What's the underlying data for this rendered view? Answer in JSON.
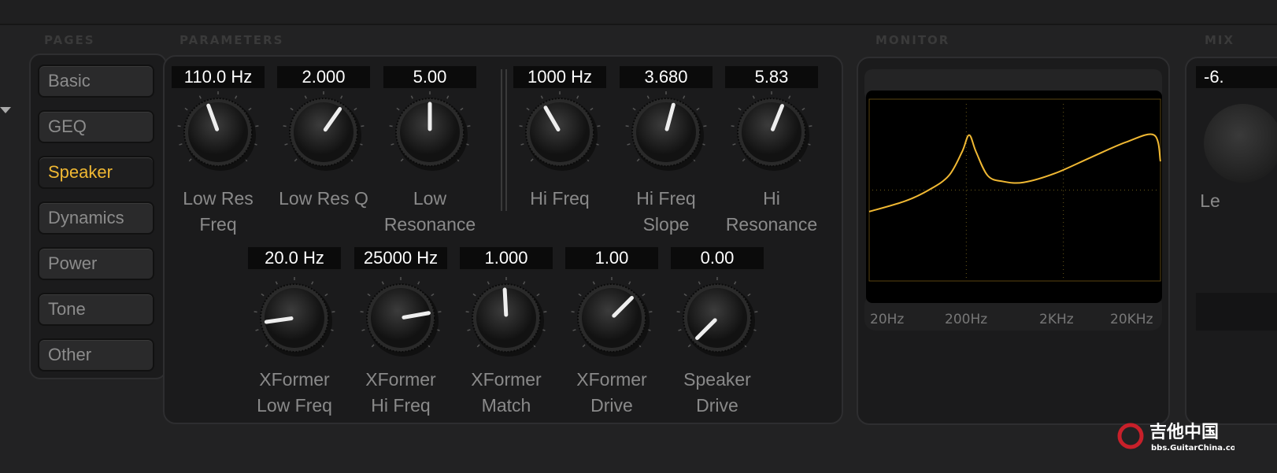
{
  "sections": {
    "pages": "PAGES",
    "parameters": "PARAMETERS",
    "monitor": "MONITOR",
    "mix": "MIX"
  },
  "pages": [
    {
      "label": "Basic",
      "active": false
    },
    {
      "label": "GEQ",
      "active": false
    },
    {
      "label": "Speaker",
      "active": true
    },
    {
      "label": "Dynamics",
      "active": false
    },
    {
      "label": "Power",
      "active": false
    },
    {
      "label": "Tone",
      "active": false
    },
    {
      "label": "Other",
      "active": false
    }
  ],
  "accent_color": "#f0b833",
  "knobs_row1": [
    {
      "value": "110.0 Hz",
      "label1": "Low Res",
      "label2": "Freq",
      "angle_deg": -20
    },
    {
      "value": "2.000",
      "label1": "Low Res Q",
      "label2": "",
      "angle_deg": 35
    },
    {
      "value": "5.00",
      "label1": "Low",
      "label2": "Resonance",
      "angle_deg": 0
    },
    {
      "value": "1000 Hz",
      "label1": "Hi Freq",
      "label2": "",
      "angle_deg": -30
    },
    {
      "value": "3.680",
      "label1": "Hi Freq",
      "label2": "Slope",
      "angle_deg": 15
    },
    {
      "value": "5.83",
      "label1": "Hi",
      "label2": "Resonance",
      "angle_deg": 22
    }
  ],
  "knobs_row2": [
    {
      "value": "20.0 Hz",
      "label1": "XFormer",
      "label2": "Low Freq",
      "angle_deg": -98
    },
    {
      "value": "25000 Hz",
      "label1": "XFormer",
      "label2": "Hi Freq",
      "angle_deg": 80
    },
    {
      "value": "1.000",
      "label1": "XFormer",
      "label2": "Match",
      "angle_deg": -3
    },
    {
      "value": "1.00",
      "label1": "XFormer",
      "label2": "Drive",
      "angle_deg": 45
    },
    {
      "value": "0.00",
      "label1": "Speaker",
      "label2": "Drive",
      "angle_deg": -135
    }
  ],
  "mix": {
    "value": "-6.",
    "label": "Le"
  },
  "chart_data": {
    "type": "line",
    "xscale": "log",
    "xlim": [
      20,
      20000
    ],
    "ylim": [
      -19,
      19
    ],
    "grid": true,
    "x_tick_labels": [
      "20Hz",
      "200Hz",
      "2KHz",
      "20KHz"
    ],
    "line_color": "#f0b833",
    "points": [
      [
        20,
        -4.5
      ],
      [
        47,
        -2.3
      ],
      [
        82,
        0
      ],
      [
        132,
        3
      ],
      [
        181,
        8
      ],
      [
        214,
        11.5
      ],
      [
        252,
        8
      ],
      [
        333,
        3
      ],
      [
        478,
        1.8
      ],
      [
        778,
        1.6
      ],
      [
        1641,
        3.5
      ],
      [
        3811,
        6.8
      ],
      [
        8800,
        10
      ],
      [
        17200,
        11.5
      ],
      [
        20000,
        6
      ]
    ]
  },
  "watermark": {
    "text": "吉他中国",
    "sub": "bbs.GuitarChina.com"
  }
}
